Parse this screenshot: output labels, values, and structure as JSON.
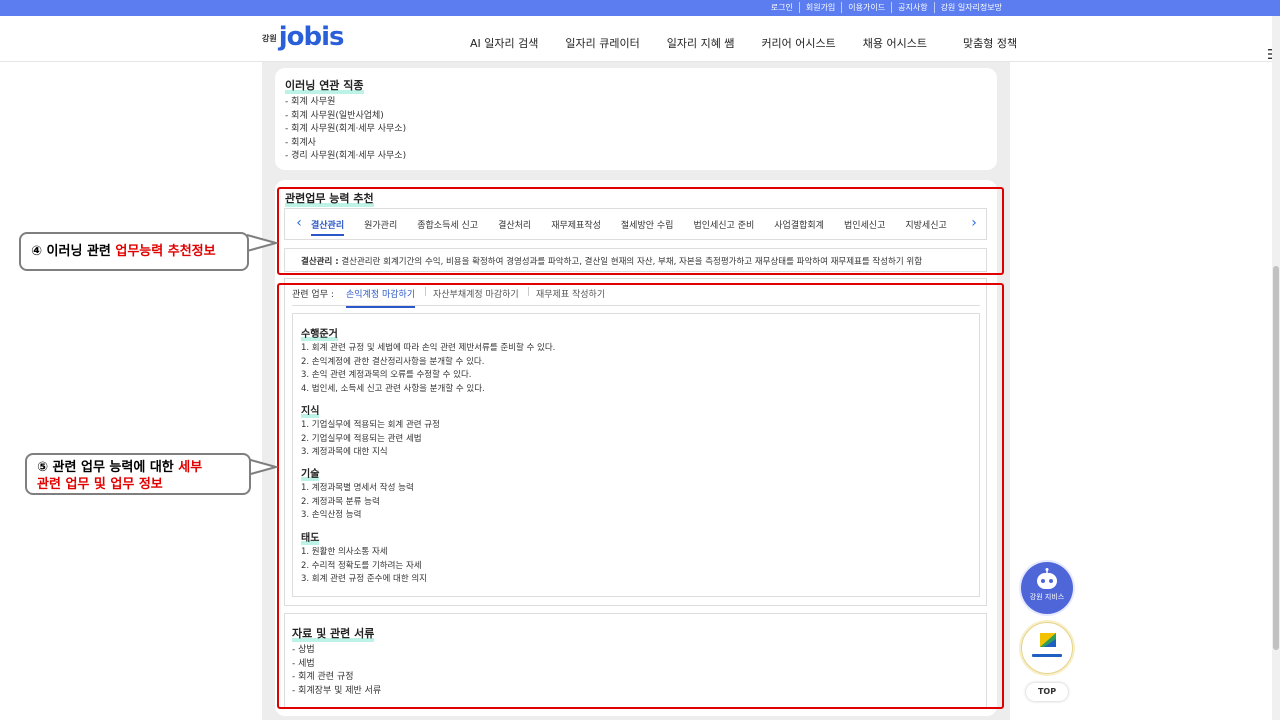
{
  "top_links": [
    "로그인",
    "회원가입",
    "이용가이드",
    "공지사항",
    "강원 일자리정보망"
  ],
  "logo": {
    "prefix": "강원",
    "name": "jobis"
  },
  "gnb": [
    "AI 일자리 검색",
    "일자리 큐레이터",
    "일자리 지혜 쌤",
    "커리어 어시스트",
    "채용 어시스트",
    "맞춤형 정책"
  ],
  "related_jobs": {
    "title": "이러닝 연관 직종",
    "items": [
      "- 회계 사무원",
      "- 회계 사무원(일반사업체)",
      "- 회계 사무원(회계·세무 사무소)",
      "- 회계사",
      "- 경리 사무원(회계·세무 사무소)"
    ]
  },
  "ability": {
    "title": "관련업무 능력 추천",
    "tabs": [
      "결산관리",
      "원가관리",
      "종합소득세 신고",
      "결산처리",
      "재무제표작성",
      "절세방안 수립",
      "법인세신고 준비",
      "사업결합회계",
      "법인세신고",
      "지방세신고"
    ],
    "active_tab": 0,
    "desc_label": "결산관리 :",
    "desc_text": " 결산관리란 회계기간의 수익, 비용을 확정하여 경영성과를 파악하고, 결산일 현재의 자산, 부채, 자본을 측정평가하고 재무상태를 파악하여 재무제표를 작성하기 위함"
  },
  "related_work": {
    "label": "관련 업무 :",
    "tabs": [
      "손익계정 마감하기",
      "자산부채계정 마감하기",
      "재무제표 작성하기"
    ],
    "sections": [
      {
        "title": "수행준거",
        "items": [
          "1. 회계 관련 규정 및 세법에 따라 손익 관련 제반서류를 준비할 수 있다.",
          "2. 손익계정에 관한 결산정리사항을 분개할 수 있다.",
          "3. 손익 관련 계정과목의 오류를 수정할 수 있다.",
          "4. 법인세, 소득세 신고 관련 사항을 분개할 수 있다."
        ]
      },
      {
        "title": "지식",
        "items": [
          "1. 기업실무에 적용되는 회계 관련 규정",
          "2. 기업실무에 적용되는 관련 세법",
          "3. 계정과목에 대한 지식"
        ]
      },
      {
        "title": "기술",
        "items": [
          "1. 계정과목별 명세서 작성 능력",
          "2. 계정과목 분류 능력",
          "3. 손익산정 능력"
        ]
      },
      {
        "title": "태도",
        "items": [
          "1. 원활한 의사소통 자세",
          "2. 수리적 정확도를 기하려는 자세",
          "3. 회계 관련 규정 준수에 대한 의지"
        ]
      }
    ]
  },
  "documents": {
    "title": "자료 및 관련 서류",
    "items": [
      "- 상법",
      "- 세법",
      "- 회계 관련 규정",
      "- 회계장부 및 제반 서류"
    ]
  },
  "callouts": {
    "c4_prefix": "④ 이러닝 관련 ",
    "c4_red": "업무능력 추천정보",
    "c5_prefix": "⑤ 관련 업무 능력에 대한 ",
    "c5_red1": "세부",
    "c5_red2": "관련 업무 및 업무 정보"
  },
  "fab": {
    "assistant_label": "강원 지비스",
    "top_label": "TOP"
  },
  "colors": {
    "topbar": "#5b7df0",
    "accent": "#2b57c8",
    "highlight": "#bdf2e6",
    "annotation_red": "#e00000"
  }
}
